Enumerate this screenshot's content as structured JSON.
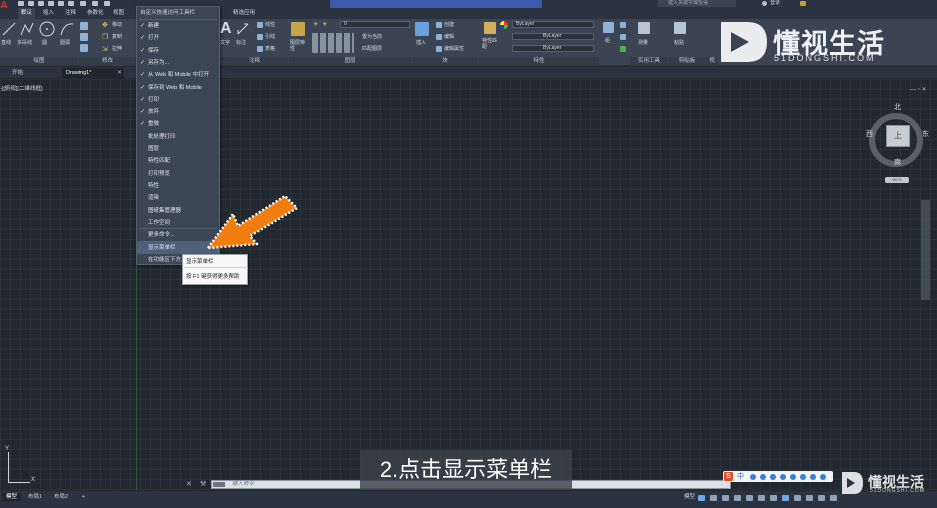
{
  "ribbon_tabs": [
    "默认",
    "插入",
    "注释",
    "参数化",
    "视图"
  ],
  "ribbon_tab_extra": "精选应用",
  "search": {
    "placeholder": "键入关键字或短语"
  },
  "login": "登录",
  "ribbon": {
    "draw_tools": [
      "直线",
      "多段线",
      "圆",
      "圆弧"
    ],
    "modify_tools": [
      "移动",
      "复制",
      "拉伸"
    ],
    "annotation_tools": [
      "文字",
      "标注"
    ],
    "annotation_small": [
      "线性",
      "引线",
      "表格"
    ],
    "layer_label_1": "图层特性",
    "layer_items": [
      "置为当前",
      "匹配图层"
    ],
    "layer_value": "0",
    "block_items": [
      "创建",
      "编辑",
      "编辑属性"
    ],
    "block_label": "插入",
    "properties_label": "特性匹配",
    "bylayer": [
      "ByLayer",
      "ByLayer",
      "ByLayer"
    ],
    "group_label": "组",
    "measure_label": "测量",
    "paste_label": "粘贴",
    "groups": [
      "绘图",
      "修改",
      "注释",
      "图层",
      "块",
      "特性",
      "实用工具",
      "剪贴板",
      "视"
    ]
  },
  "file_tabs": [
    "开始",
    "Drawing1*"
  ],
  "viewport_label": "-][俯视][二维线框]",
  "viewport_ctrl": "— ▫ ✕",
  "viewcube": {
    "face": "上",
    "north": "北",
    "south": "南",
    "east": "东",
    "west": "西",
    "wcs": "WCS"
  },
  "ucs": {
    "x": "X",
    "y": "Y"
  },
  "menu": {
    "header": "自定义快速访问工具栏",
    "items": [
      {
        "label": "新建",
        "checked": true
      },
      {
        "label": "打开",
        "checked": true
      },
      {
        "label": "保存",
        "checked": true
      },
      {
        "label": "另存为...",
        "checked": true
      },
      {
        "label": "从 Web 和 Mobile 中打开",
        "checked": true
      },
      {
        "label": "保存到 Web 和 Mobile",
        "checked": true
      },
      {
        "label": "打印",
        "checked": true
      },
      {
        "label": "放弃",
        "checked": true
      },
      {
        "label": "重做",
        "checked": true
      },
      {
        "label": "批处理打印",
        "checked": false
      },
      {
        "label": "图层",
        "checked": false
      },
      {
        "label": "特性匹配",
        "checked": false
      },
      {
        "label": "打印预览",
        "checked": false
      },
      {
        "label": "特性",
        "checked": false
      },
      {
        "label": "渲染",
        "checked": false
      },
      {
        "label": "图纸集管理器",
        "checked": false
      },
      {
        "label": "工作空间",
        "checked": false
      }
    ],
    "more": "更多命令...",
    "show_menubar": "显示菜单栏",
    "below_ribbon": "在功能区下方显示"
  },
  "tooltip": {
    "title": "显示菜单栏",
    "help": "按 F1 键获得更多帮助"
  },
  "command": {
    "close": "✕",
    "placeholder": "键入命令"
  },
  "status": {
    "tabs": [
      "模型",
      "布局1",
      "布局2"
    ],
    "add": "+",
    "model": "模型"
  },
  "ime": {
    "s": "S",
    "zh": "中"
  },
  "subtitle": "2.点击显示菜单栏",
  "watermark": {
    "text": "懂视生活",
    "sub": "51DONGSHI.COM"
  },
  "colors": {
    "arrow": "#f07d0f",
    "accent": "#3b5ba8",
    "ime_red": "#e94b2a"
  }
}
